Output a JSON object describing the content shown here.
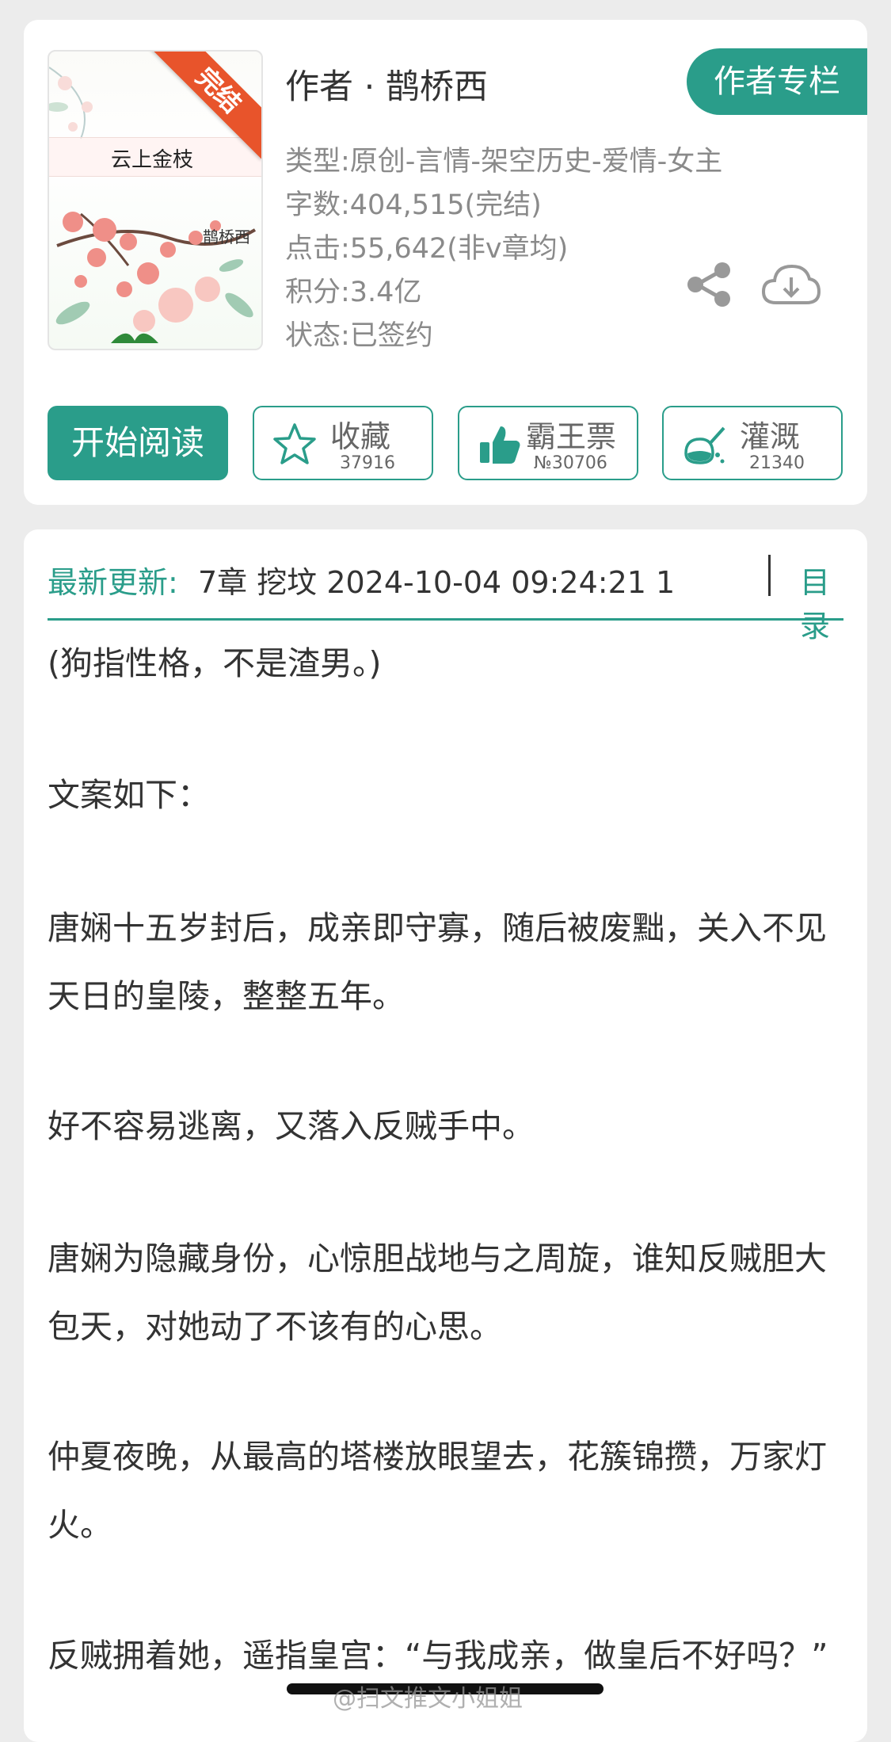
{
  "book": {
    "author_line": "作者 · 鹊桥西",
    "column_button": "作者专栏",
    "meta": [
      "类型:原创-言情-架空历史-爱情-女主",
      "字数:404,515(完结)",
      "点击:55,642(非v章均)",
      "积分:3.4亿",
      "状态:已签约"
    ]
  },
  "cover": {
    "title": "云上金枝",
    "author": "鹊桥西",
    "ribbon": "完结"
  },
  "actions": {
    "start": "开始阅读",
    "favorite": {
      "label": "收藏",
      "count": "37916"
    },
    "overlord": {
      "label": "霸王票",
      "count": "№30706"
    },
    "water": {
      "label": "灌溉",
      "count": "21340"
    }
  },
  "update": {
    "label": "最新更新:",
    "text": "7章 挖坟 2024-10-04 09:24:21 1",
    "toc": "目录"
  },
  "paragraphs": [
    "(狗指性格，不是渣男。)",
    "文案如下：",
    "唐娴十五岁封后，成亲即守寡，随后被废黜，关入不见天日的皇陵，整整五年。",
    "好不容易逃离，又落入反贼手中。",
    "唐娴为隐藏身份，心惊胆战地与之周旋，谁知反贼胆大包天，对她动了不该有的心思。",
    "仲夏夜晚，从最高的塔楼放眼望去，花簇锦攒，万家灯火。",
    "反贼拥着她，遥指皇宫：“与我成亲，做皇后不好吗？”"
  ],
  "watermark": "@扫文推文小姐姐",
  "colors": {
    "accent": "#2a9d8a",
    "ribbon": "#e8542b",
    "meta": "#8a8a8a"
  },
  "icons": [
    "share-icon",
    "download-icon",
    "star-icon",
    "thumbs-up-icon",
    "watering-can-icon"
  ]
}
